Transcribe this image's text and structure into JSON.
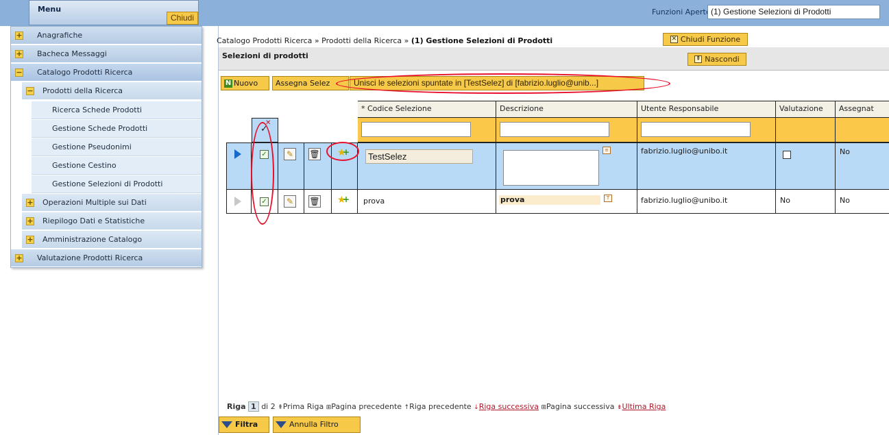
{
  "topbar": {
    "funzioni_label": "Funzioni Aperte:",
    "funzioni_value": "(1) Gestione Selezioni di Prodotti"
  },
  "menu": {
    "title": "Menu",
    "close_label": "Chiudi",
    "items": [
      {
        "label": "Anagrafiche",
        "toggle": "+"
      },
      {
        "label": "Bacheca Messaggi",
        "toggle": "+"
      },
      {
        "label": "Catalogo Prodotti Ricerca",
        "toggle": "−"
      },
      {
        "label": "Prodotti della Ricerca",
        "toggle": "−"
      },
      {
        "label": "Ricerca Schede Prodotti"
      },
      {
        "label": "Gestione Schede Prodotti"
      },
      {
        "label": "Gestione Pseudonimi"
      },
      {
        "label": "Gestione Cestino"
      },
      {
        "label": "Gestione Selezioni di Prodotti"
      },
      {
        "label": "Operazioni Multiple sui Dati",
        "toggle": "+"
      },
      {
        "label": "Riepilogo Dati e Statistiche",
        "toggle": "+"
      },
      {
        "label": "Amministrazione Catalogo",
        "toggle": "+"
      },
      {
        "label": "Valutazione Prodotti Ricerca",
        "toggle": "+"
      }
    ]
  },
  "breadcrumb": {
    "part1": "Catalogo Prodotti Ricerca »",
    "part2": "Prodotti della Ricerca »",
    "current": "(1) Gestione Selezioni di Prodotti"
  },
  "chiudi_funzione": "Chiudi Funzione",
  "panel": {
    "title": "Selezioni di prodotti",
    "nascondi": "Nascondi"
  },
  "toolbar": {
    "nuovo": "Nuovo",
    "assegna": "Assegna Selez",
    "unisci": "Unisci le selezioni spuntate in [TestSelez] di [fabrizio.luglio@unib...]"
  },
  "grid": {
    "columns": [
      "* Codice Selezione",
      "Descrizione",
      "Utente Responsabile",
      "Valutazione",
      "Assegnat"
    ],
    "rows": [
      {
        "codice": "TestSelez",
        "descrizione": "",
        "utente": "fabrizio.luglio@unibo.it",
        "valutazione": "",
        "assegnato": "No"
      },
      {
        "codice": "prova",
        "descrizione": "prova",
        "utente": "fabrizio.luglio@unibo.it",
        "valutazione": "No",
        "assegnato": "No"
      }
    ]
  },
  "pager": {
    "riga_label": "Riga",
    "current": "1",
    "of": "di 2",
    "prima": "Prima Riga",
    "pag_prec": "Pagina precedente",
    "riga_prec": "Riga precedente",
    "riga_succ": "Riga successiva",
    "pag_succ": "Pagina successiva",
    "ultima": "Ultima Riga"
  },
  "filters": {
    "filtra": "Filtra",
    "annulla": "Annulla Filtro"
  },
  "colors": {
    "accent": "#f7c948",
    "topbar": "#8bb1db",
    "selected_row": "#b9daf6",
    "annotation": "#e8102a"
  }
}
